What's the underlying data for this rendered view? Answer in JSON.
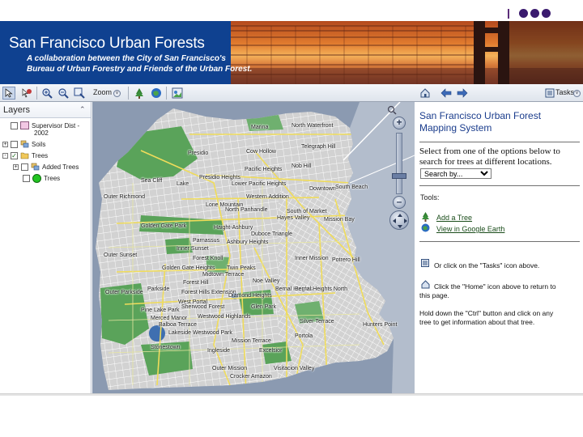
{
  "banner": {
    "title": "San Francisco Urban Forests",
    "subtitle_line1": "A collaboration between the City of San Francisco's",
    "subtitle_line2": "Bureau of Urban Forestry and Friends of the Urban Forest."
  },
  "toolbar": {
    "zoom_label": "Zoom",
    "tasks_label": "Tasks"
  },
  "layers": {
    "header": "Layers",
    "items": [
      {
        "label": "Supervisor Dist -",
        "label2": "2002"
      },
      {
        "label": "Soils"
      },
      {
        "label": "Trees",
        "checked": true
      },
      {
        "label": "Added Trees"
      },
      {
        "label": "Trees"
      }
    ]
  },
  "map": {
    "labels": [
      "Marina",
      "North Waterfront",
      "Telegraph Hill",
      "Cow Hollow",
      "Presidio",
      "Pacific Heights",
      "Nob Hill",
      "Sea Cliff",
      "Presidio Heights",
      "Lake",
      "Lower Pacific Heights",
      "Downtown",
      "South Beach",
      "Outer Richmond",
      "Western Addition",
      "Lone Mountain",
      "North Panhandle",
      "Hayes Valley",
      "South of Market",
      "Mission Bay",
      "Golden Gate Park",
      "Haight-Ashbury",
      "Duboce Triangle",
      "Parnassus",
      "Ashbury Heights",
      "Inner Sunset",
      "Outer Sunset",
      "Forest Knoll",
      "Inner Mission",
      "Potrero Hill",
      "Golden Gate Heights",
      "Twin Peaks",
      "Midtown Terrace",
      "Forest Hill",
      "Noe Valley",
      "Bernal Heights",
      "Parkside",
      "Forest Hills Extension",
      "Bernal Heights North",
      "Outer Parkside",
      "Diamond Heights",
      "West Portal",
      "Sherwood Forest",
      "Glen Park",
      "Pine Lake Park",
      "Merced Manor",
      "Balboa Terrace",
      "Westwood Highlands",
      "Silver Terrace",
      "Hunters Point",
      "Lakeside",
      "Westwood Park",
      "Portola",
      "Mission Terrace",
      "Stonestown",
      "Ingleside",
      "Excelsior",
      "Outer Mission",
      "Visitacion Valley",
      "Crocker Amazon"
    ]
  },
  "tasks": {
    "title_line1": "San Francisco Urban Forest",
    "title_line2": "Mapping System",
    "select_prompt_line1": "Select from one of the options below to",
    "select_prompt_line2": "search for trees at different locations.",
    "search_select_value": "Search by...",
    "tools_label": "Tools:",
    "add_tree_link": "Add a Tree",
    "google_earth_link": "View in Google Earth",
    "tasks_hint": "Or click on the \"Tasks\" icon above.",
    "home_hint_line1": "Click the \"Home\" icon above to return to",
    "home_hint_line2": "this page.",
    "ctrl_hint_line1": "Hold down the \"Ctrl\" button and click on any",
    "ctrl_hint_line2": "tree to get information about that tree."
  },
  "colors": {
    "banner_blue": "#0f4190",
    "title_blue": "#1a3c8c",
    "link_green": "#1a4c1a",
    "water": "#8a99b0",
    "land": "#cfcfcf",
    "park": "#5aa35a",
    "road": "#f2e06a"
  }
}
